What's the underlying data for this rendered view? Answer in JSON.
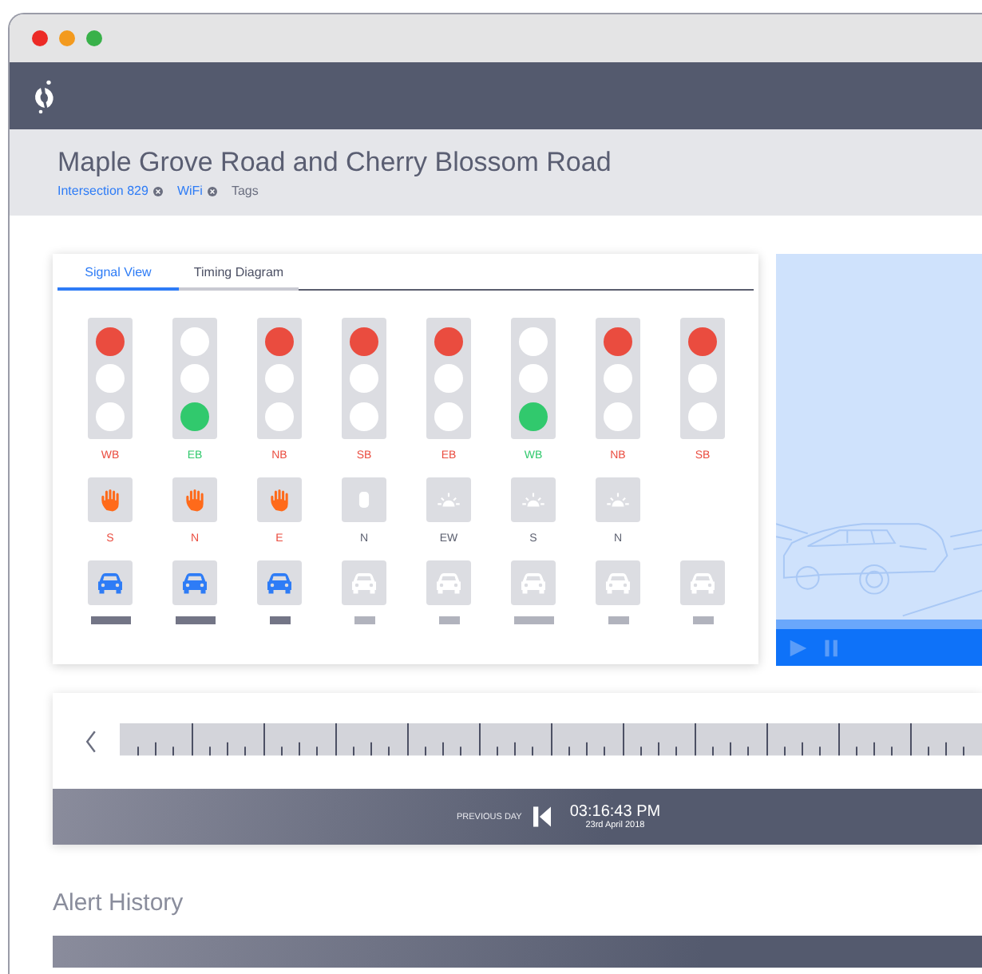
{
  "header": {
    "title": "Maple Grove Road and Cherry Blossom Road",
    "tags": [
      {
        "label": "Intersection 829",
        "removable": true
      },
      {
        "label": "WiFi",
        "removable": true
      }
    ],
    "tags_label": "Tags"
  },
  "tabs": [
    {
      "label": "Signal View",
      "selected": true
    },
    {
      "label": "Timing Diagram",
      "selected": false
    }
  ],
  "signals": [
    {
      "label": "WB",
      "red": true,
      "green": false
    },
    {
      "label": "EB",
      "red": false,
      "green": true
    },
    {
      "label": "NB",
      "red": true,
      "green": false
    },
    {
      "label": "SB",
      "red": true,
      "green": false
    },
    {
      "label": "EB",
      "red": true,
      "green": false
    },
    {
      "label": "WB",
      "red": false,
      "green": true
    },
    {
      "label": "NB",
      "red": true,
      "green": false
    },
    {
      "label": "SB",
      "red": true,
      "green": false
    }
  ],
  "pedestrians": [
    {
      "label": "S",
      "kind": "hand"
    },
    {
      "label": "N",
      "kind": "hand"
    },
    {
      "label": "E",
      "kind": "hand"
    },
    {
      "label": "N",
      "kind": "blank"
    },
    {
      "label": "EW",
      "kind": "beacon"
    },
    {
      "label": "S",
      "kind": "beacon"
    },
    {
      "label": "N",
      "kind": "beacon"
    }
  ],
  "vehicles": [
    {
      "active": true,
      "wide": true
    },
    {
      "active": true,
      "wide": true
    },
    {
      "active": true,
      "wide": false
    },
    {
      "active": false,
      "wide": false
    },
    {
      "active": false,
      "wide": false
    },
    {
      "active": false,
      "wide": true
    },
    {
      "active": false,
      "wide": false
    },
    {
      "active": false,
      "wide": false
    }
  ],
  "video": {
    "level": 1
  },
  "timeline": {
    "previous_label": "PREVIOUS DAY",
    "time": "03:16:43 PM",
    "date": "23rd April 2018"
  },
  "alert_history": {
    "title": "Alert History"
  }
}
